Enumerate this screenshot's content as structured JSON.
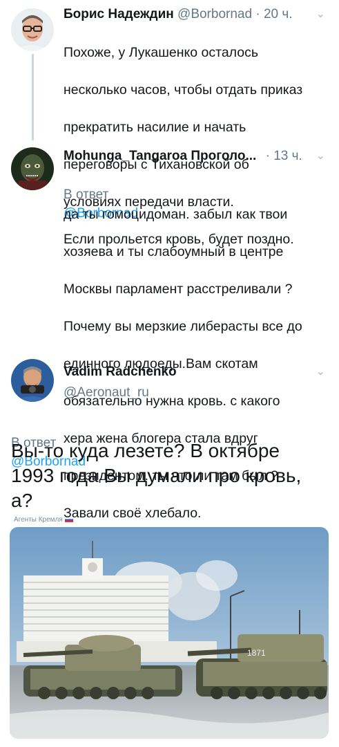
{
  "tweets": [
    {
      "name": "Борис Надеждин",
      "handle": "@Borbornad",
      "separator": "·",
      "time": "20 ч.",
      "lines": [
        "Похоже, у Лукашенко осталось",
        "несколько часов, чтобы отдать приказ",
        "прекратить насилие и начать",
        "переговоры с Тихановской об",
        "условиях передачи власти.",
        "Если прольется кровь, будет поздно."
      ]
    },
    {
      "name": "Mohunga_Tangaroa Проголо...",
      "separator": "·",
      "time": "13 ч.",
      "reply_prefix": "В ответ",
      "reply_mention": "@Borbornad",
      "lines": [
        "да ты гомоцидоман. забыл как твои",
        "хозяева и ты слабоумный в центре",
        "Москвы парламент расстреливали ?",
        "Почему вы мерзкие либерасты все до",
        "единного людоеды.Вам скотам",
        "обязательно нужна кровь. с какого",
        "хера жена блогера стала вдруг",
        "президентом. ты что ли там был ?",
        "Завали своё хлебало."
      ]
    },
    {
      "name": "Vadim Radchenko",
      "handle": "@Aeronaut_ru",
      "reply_prefix": "В ответ",
      "reply_mention": "@Borbornad",
      "text": "Вы-то куда лезете? В октябре 1993 года Вы думали про кровь, а?"
    }
  ],
  "watermark": "Агенты Кремля",
  "icons": {
    "caret": "chevron-down-icon"
  },
  "colors": {
    "link": "#1da1f2",
    "secondary": "#657786",
    "thread_line": "#ccd6dd"
  }
}
